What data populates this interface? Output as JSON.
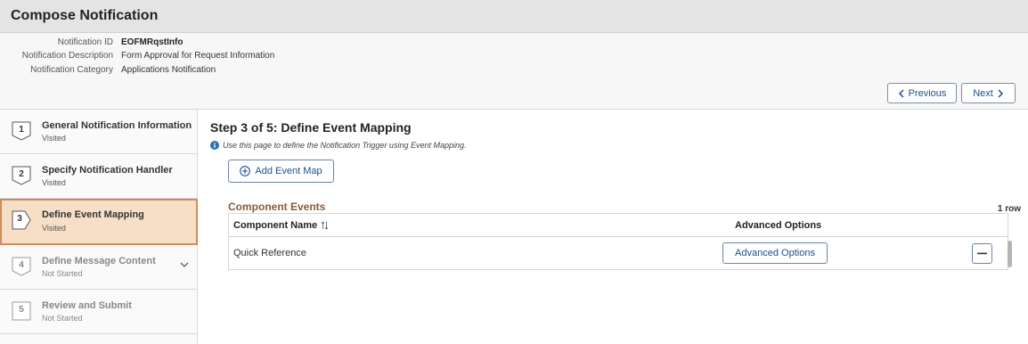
{
  "page": {
    "title": "Compose Notification"
  },
  "header": {
    "fields": [
      {
        "label": "Notification ID",
        "value": "EOFMRqstInfo"
      },
      {
        "label": "Notification Description",
        "value": "Form Approval for Request Information"
      },
      {
        "label": "Notification Category",
        "value": "Applications Notification"
      }
    ],
    "previous_label": "Previous",
    "next_label": "Next"
  },
  "steps": [
    {
      "num": "1",
      "title": "General Notification Information",
      "status": "Visited",
      "state": "visited"
    },
    {
      "num": "2",
      "title": "Specify Notification Handler",
      "status": "Visited",
      "state": "visited"
    },
    {
      "num": "3",
      "title": "Define Event Mapping",
      "status": "Visited",
      "state": "active"
    },
    {
      "num": "4",
      "title": "Define Message Content",
      "status": "Not Started",
      "state": "not-started"
    },
    {
      "num": "5",
      "title": "Review and Submit",
      "status": "Not Started",
      "state": "not-started"
    }
  ],
  "main": {
    "heading": "Step 3 of 5: Define Event Mapping",
    "info": "Use this page to define the Notification Trigger using Event Mapping.",
    "add_event_map_label": "Add Event Map",
    "grid": {
      "title": "Component Events",
      "row_count": "1 row",
      "columns": [
        "Component Name",
        "Advanced Options"
      ],
      "rows": [
        {
          "component_name": "Quick Reference",
          "advanced_label": "Advanced Options"
        }
      ]
    }
  },
  "colors": {
    "accent": "#1d4f8a",
    "active_step_bg": "#f7dfc7",
    "active_step_border": "#cf8c5b",
    "grid_title": "#8b5a34",
    "info_icon": "#2f6fb5"
  },
  "icons": {
    "previous": "chevron-left-icon",
    "next": "chevron-right-icon",
    "info": "info-icon",
    "add": "plus-circle-icon",
    "sort": "sort-icon",
    "delete": "minus-icon",
    "expand": "chevron-down-icon"
  }
}
